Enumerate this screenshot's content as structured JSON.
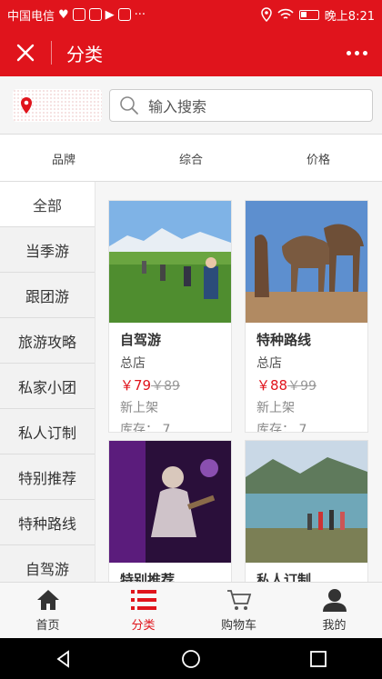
{
  "status_bar": {
    "carrier": "中国电信",
    "dots": "···",
    "time": "晚上8:21",
    "icons": [
      "heart-icon",
      "app-icon",
      "mail-icon",
      "play-icon",
      "image-icon",
      "location-icon",
      "wifi-icon",
      "battery-icon"
    ]
  },
  "header": {
    "title": "分类",
    "close_icon": "close-icon",
    "more_icon": "more-icon",
    "accent": "#e0141c"
  },
  "search": {
    "placeholder": "输入搜索",
    "location_icon": "location-pin-icon"
  },
  "sort_bar": [
    "品牌",
    "综合",
    "价格"
  ],
  "sidebar": {
    "items": [
      "全部",
      "当季游",
      "跟团游",
      "旅游攻略",
      "私家小团",
      "私人订制",
      "特别推荐",
      "特种路线",
      "自驾游"
    ],
    "active_index": 0
  },
  "products": [
    {
      "title": "自驾游",
      "shop": "总店",
      "price": "￥79",
      "old_price": "￥89",
      "tag": "新上架",
      "stock": "库存： 7"
    },
    {
      "title": "特种路线",
      "shop": "总店",
      "price": "￥88",
      "old_price": "￥99",
      "tag": "新上架",
      "stock": "库存： 7"
    },
    {
      "title": "特别推荐",
      "shop": "",
      "price": "",
      "old_price": "",
      "tag": "",
      "stock": ""
    },
    {
      "title": "私人订制",
      "shop": "",
      "price": "",
      "old_price": "",
      "tag": "",
      "stock": ""
    }
  ],
  "tab_bar": {
    "items": [
      {
        "label": "首页",
        "icon": "home-icon"
      },
      {
        "label": "分类",
        "icon": "category-icon"
      },
      {
        "label": "购物车",
        "icon": "cart-icon"
      },
      {
        "label": "我的",
        "icon": "user-icon"
      }
    ],
    "active_index": 1
  },
  "system_nav": [
    "back-icon",
    "home-circle-icon",
    "recents-icon"
  ]
}
